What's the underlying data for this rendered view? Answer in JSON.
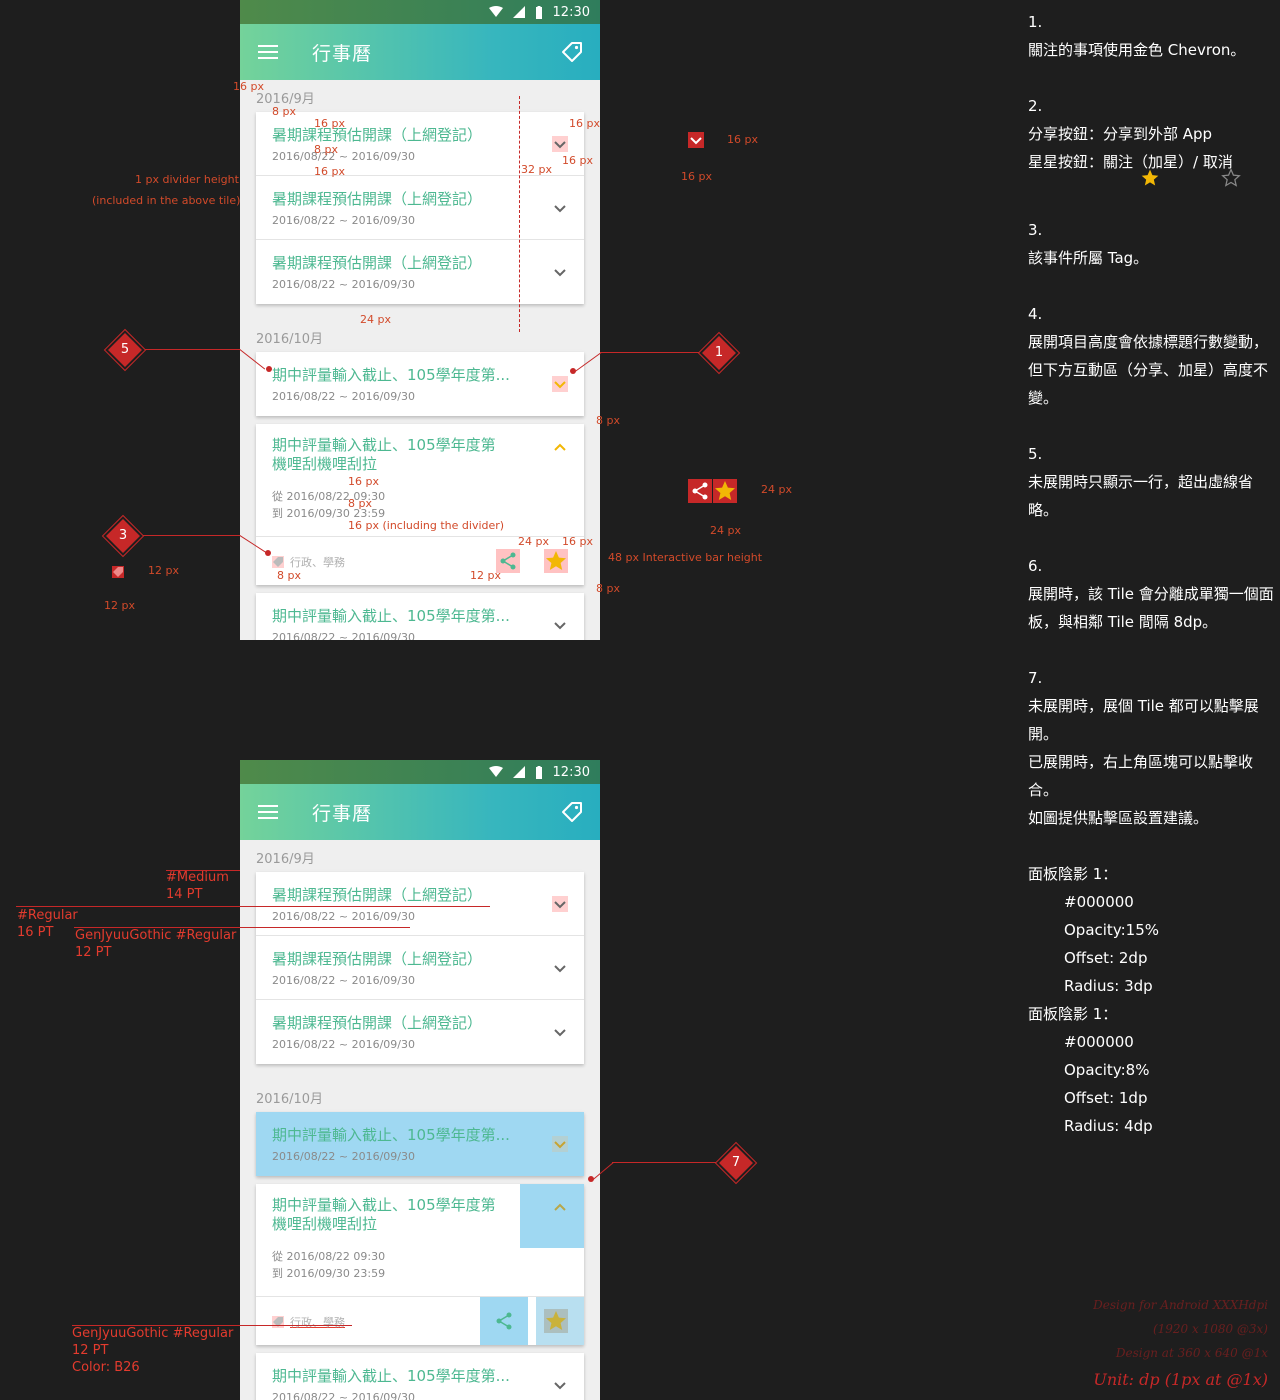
{
  "status": {
    "time": "12:30"
  },
  "toolbar": {
    "title": "行事曆"
  },
  "sections": {
    "sep": "2016/9月",
    "oct": "2016/10月"
  },
  "tiles": {
    "sep_title": "暑期課程預估開課（上網登記）",
    "sep_date": "2016/08/22 ~ 2016/09/30",
    "oct_title_short": "期中評量輸入截止、105學年度第...",
    "oct_date": "2016/08/22 ~ 2016/09/30",
    "exp_title_line1": "期中評量輸入截止、105學年度第",
    "exp_title_line2": "機哩刮機哩刮拉",
    "exp_from": "從 2016/08/22 09:30",
    "exp_to": "到 2016/09/30 23:59",
    "exp_tags": "行政、學務"
  },
  "annotations": {
    "px16": "16 px",
    "px8": "8 px",
    "px32": "32 px",
    "px24": "24 px",
    "px12": "12 px",
    "divider_height": "1 px divider height",
    "divider_included": "(included in the above tile)",
    "px16_divider": "16 px (including the divider)",
    "interactive_bar": "48 px Interactive bar height"
  },
  "badges": {
    "b1": "1",
    "b3": "3",
    "b5": "5",
    "b7": "7"
  },
  "type_labels": {
    "medium14_a": "#Medium",
    "medium14_b": "14 PT",
    "regular16_a": "#Regular",
    "regular16_b": "16 PT",
    "gothic12_a": "GenJyuuGothic #Regular",
    "gothic12_b": "12 PT",
    "gothic12c_a": "GenJyuuGothic #Regular",
    "gothic12c_b": "12 PT",
    "gothic12c_c": "Color: B26"
  },
  "notes": {
    "n1_num": "1.",
    "n1": "關注的事項使用金色 Chevron。",
    "n2_num": "2.",
    "n2a": "分享按鈕：分享到外部 App",
    "n2b": "星星按鈕：關注（加星）/ 取消",
    "n3_num": "3.",
    "n3": "該事件所屬 Tag。",
    "n4_num": "4.",
    "n4": "展開項目高度會依據標題行數變動，但下方互動區（分享、加星）高度不變。",
    "n5_num": "5.",
    "n5": "未展開時只顯示一行，超出虛線省略。",
    "n6_num": "6.",
    "n6": "展開時，該 Tile 會分離成單獨一個面板，與相鄰 Tile 間隔 8dp。",
    "n7_num": "7.",
    "n7a": "未展開時，展個 Tile 都可以點擊展開。",
    "n7b": "已展開時，右上角區塊可以點擊收合。",
    "n7c": "如圖提供點擊區設置建議。",
    "shadow1_title": "面板陰影 1：",
    "shadow1_color": "#000000",
    "shadow1_opacity": "Opacity:15%",
    "shadow1_offset": "Offset: 2dp",
    "shadow1_radius": "Radius: 3dp",
    "shadow2_title": "面板陰影 1：",
    "shadow2_color": "#000000",
    "shadow2_opacity": "Opacity:8%",
    "shadow2_offset": "Offset: 1dp",
    "shadow2_radius": "Radius: 4dp"
  },
  "footer": {
    "f1": "Design for Android XXXHdpi",
    "f2": "(1920 x 1080 @3x)",
    "f3": "Design at 360 x 640 @1x",
    "f4": "Unit: dp (1px at @1x)"
  },
  "colors": {
    "accent": "#4db891",
    "annotation": "#d24a2a",
    "badge": "#c62828",
    "gold": "#f2b705"
  }
}
